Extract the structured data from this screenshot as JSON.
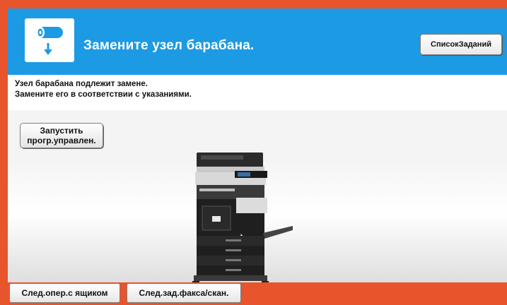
{
  "header": {
    "title": "Замените узел барабана.",
    "icon": "drum-replace-icon",
    "job_list_label": "СписокЗаданий",
    "background_color": "#1d9ae4"
  },
  "message": {
    "line1": "Узел барабана подлежит замене.",
    "line2": "Замените его в соответствии с указаниями."
  },
  "launch_button": {
    "line1": "Запустить",
    "line2": "прогр.управлен."
  },
  "illustration": {
    "icon": "multifunction-printer-icon"
  },
  "footer": {
    "next_op_box_label": "След.опер.с ящиком",
    "next_fax_scan_label": "След.зад.факса/скан."
  },
  "colors": {
    "border": "#e8542c",
    "accent": "#1d9ae4"
  }
}
